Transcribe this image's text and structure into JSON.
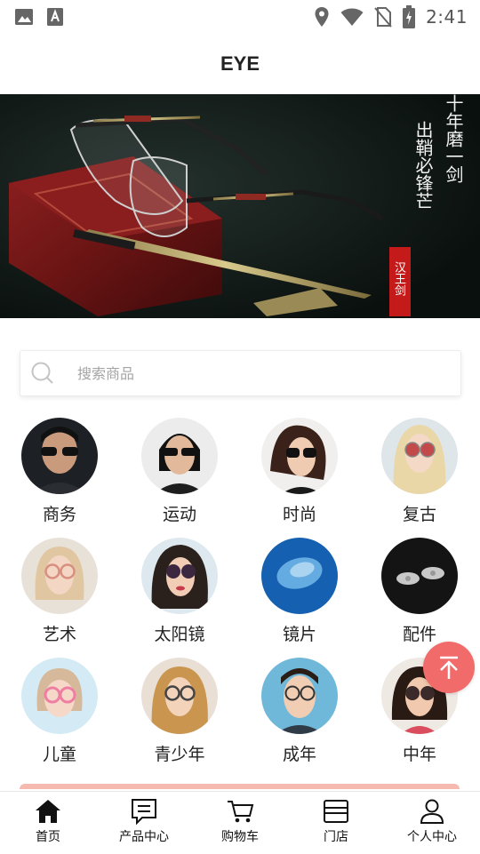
{
  "status_bar": {
    "time": "2:41",
    "icons": [
      "image-icon",
      "text-a-icon",
      "location-icon",
      "wifi-icon",
      "no-sim-icon",
      "battery-icon"
    ]
  },
  "header": {
    "title": "EYE"
  },
  "banner": {
    "text_col1": "出鞘必锋芒",
    "text_col2": "十年磨一剑",
    "seal_text": "汉王剑"
  },
  "search": {
    "placeholder": "搜索商品"
  },
  "categories": [
    {
      "label": "商务"
    },
    {
      "label": "运动"
    },
    {
      "label": "时尚"
    },
    {
      "label": "复古"
    },
    {
      "label": "艺术"
    },
    {
      "label": "太阳镜"
    },
    {
      "label": "镜片"
    },
    {
      "label": "配件"
    },
    {
      "label": "儿童"
    },
    {
      "label": "青少年"
    },
    {
      "label": "成年"
    },
    {
      "label": "中年"
    }
  ],
  "nav": {
    "items": [
      {
        "label": "首页",
        "icon": "home-icon",
        "active": true
      },
      {
        "label": "产品中心",
        "icon": "product-list-icon"
      },
      {
        "label": "购物车",
        "icon": "cart-icon"
      },
      {
        "label": "门店",
        "icon": "store-icon"
      },
      {
        "label": "个人中心",
        "icon": "user-icon"
      }
    ]
  },
  "colors": {
    "accent": "#f26b6b",
    "banner_bg": "#0d1412",
    "wood_box": "#7a1a1a"
  }
}
